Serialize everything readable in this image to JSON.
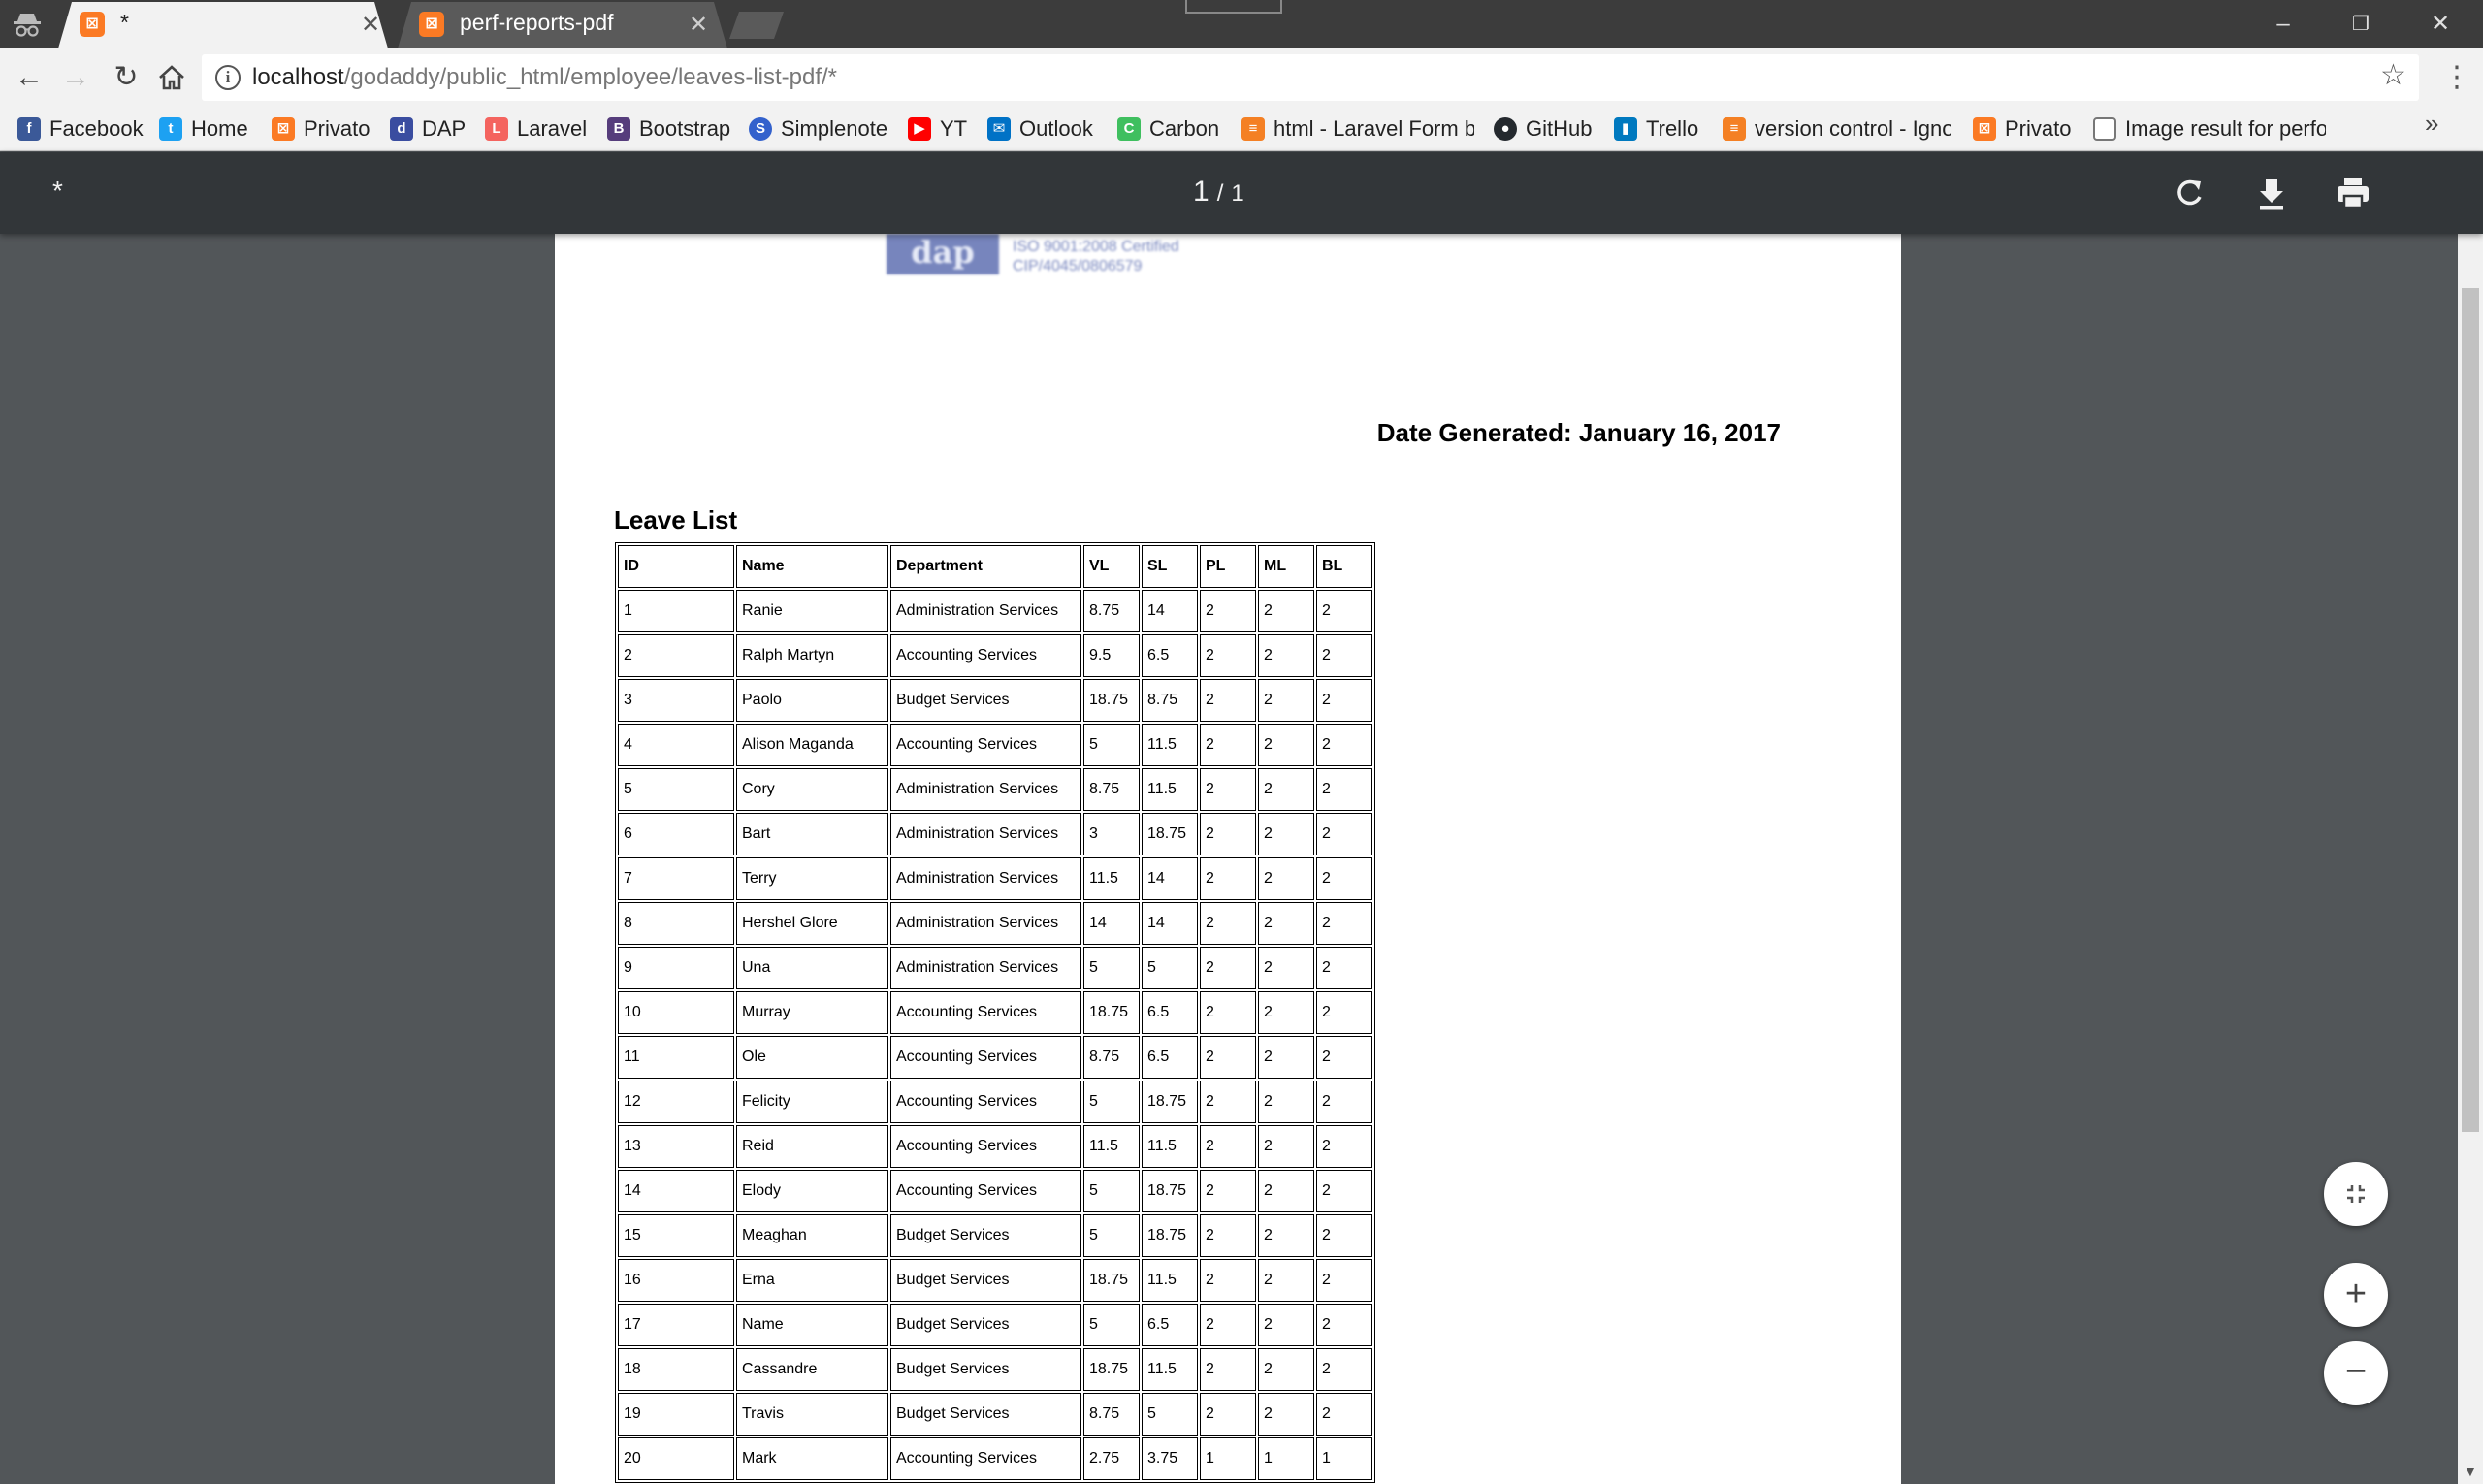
{
  "browser": {
    "tabs": [
      {
        "title": "*",
        "active": true
      },
      {
        "title": "perf-reports-pdf",
        "active": false
      }
    ],
    "address": {
      "host": "localhost",
      "path": "/godaddy/public_html/employee/leaves-list-pdf/*"
    },
    "bookmarks": [
      {
        "label": "Facebook",
        "icon": "facebook-icon",
        "color": "#3b5998"
      },
      {
        "label": "Home",
        "icon": "twitter-icon",
        "color": "#1da1f2"
      },
      {
        "label": "Privato",
        "icon": "xampp-icon",
        "color": "#fb7a24"
      },
      {
        "label": "DAP",
        "icon": "dap-icon",
        "color": "#3a4da0"
      },
      {
        "label": "Laravel",
        "icon": "laravel-icon",
        "color": "#f4645f"
      },
      {
        "label": "Bootstrap",
        "icon": "bootstrap-icon",
        "color": "#563d7c"
      },
      {
        "label": "Simplenote",
        "icon": "simplenote-icon",
        "color": "#3361cc"
      },
      {
        "label": "YT",
        "icon": "youtube-icon",
        "color": "#ff0000"
      },
      {
        "label": "Outlook",
        "icon": "outlook-icon",
        "color": "#0072c6"
      },
      {
        "label": "Carbon",
        "icon": "carbon-icon",
        "color": "#3fbf5f"
      },
      {
        "label": "html - Laravel Form b",
        "icon": "stackoverflow-icon",
        "color": "#f48024"
      },
      {
        "label": "GitHub",
        "icon": "github-icon",
        "color": "#24292e"
      },
      {
        "label": "Trello",
        "icon": "trello-icon",
        "color": "#0079bf"
      },
      {
        "label": "version control - Igno",
        "icon": "stackoverflow-icon",
        "color": "#f48024"
      },
      {
        "label": "Privato",
        "icon": "xampp-icon",
        "color": "#fb7a24"
      },
      {
        "label": "Image result for perfo",
        "icon": "page-icon",
        "color": "#777777"
      }
    ],
    "more_label": "»"
  },
  "pdf": {
    "title": "*",
    "page_current": "1",
    "page_sep": "/",
    "page_total": "1"
  },
  "document": {
    "logo_text": "dap",
    "cert_line1": "ISO 9001:2008 Certified",
    "cert_line2": "CIP/4045/0806579",
    "date_generated": "Date Generated: January 16, 2017",
    "list_title": "Leave List",
    "columns": [
      "ID",
      "Name",
      "Department",
      "VL",
      "SL",
      "PL",
      "ML",
      "BL"
    ],
    "rows": [
      [
        "1",
        "Ranie",
        "Administration Services",
        "8.75",
        "14",
        "2",
        "2",
        "2"
      ],
      [
        "2",
        "Ralph Martyn",
        "Accounting Services",
        "9.5",
        "6.5",
        "2",
        "2",
        "2"
      ],
      [
        "3",
        "Paolo",
        "Budget Services",
        "18.75",
        "8.75",
        "2",
        "2",
        "2"
      ],
      [
        "4",
        "Alison Maganda",
        "Accounting Services",
        "5",
        "11.5",
        "2",
        "2",
        "2"
      ],
      [
        "5",
        "Cory",
        "Administration Services",
        "8.75",
        "11.5",
        "2",
        "2",
        "2"
      ],
      [
        "6",
        "Bart",
        "Administration Services",
        "3",
        "18.75",
        "2",
        "2",
        "2"
      ],
      [
        "7",
        "Terry",
        "Administration Services",
        "11.5",
        "14",
        "2",
        "2",
        "2"
      ],
      [
        "8",
        "Hershel Glore",
        "Administration Services",
        "14",
        "14",
        "2",
        "2",
        "2"
      ],
      [
        "9",
        "Una",
        "Administration Services",
        "5",
        "5",
        "2",
        "2",
        "2"
      ],
      [
        "10",
        "Murray",
        "Accounting Services",
        "18.75",
        "6.5",
        "2",
        "2",
        "2"
      ],
      [
        "11",
        "Ole",
        "Accounting Services",
        "8.75",
        "6.5",
        "2",
        "2",
        "2"
      ],
      [
        "12",
        "Felicity",
        "Accounting Services",
        "5",
        "18.75",
        "2",
        "2",
        "2"
      ],
      [
        "13",
        "Reid",
        "Accounting Services",
        "11.5",
        "11.5",
        "2",
        "2",
        "2"
      ],
      [
        "14",
        "Elody",
        "Accounting Services",
        "5",
        "18.75",
        "2",
        "2",
        "2"
      ],
      [
        "15",
        "Meaghan",
        "Budget Services",
        "5",
        "18.75",
        "2",
        "2",
        "2"
      ],
      [
        "16",
        "Erna",
        "Budget Services",
        "18.75",
        "11.5",
        "2",
        "2",
        "2"
      ],
      [
        "17",
        "Name",
        "Budget Services",
        "5",
        "6.5",
        "2",
        "2",
        "2"
      ],
      [
        "18",
        "Cassandre",
        "Budget Services",
        "18.75",
        "11.5",
        "2",
        "2",
        "2"
      ],
      [
        "19",
        "Travis",
        "Budget Services",
        "8.75",
        "5",
        "2",
        "2",
        "2"
      ],
      [
        "20",
        "Mark",
        "Accounting Services",
        "2.75",
        "3.75",
        "1",
        "1",
        "1"
      ]
    ]
  }
}
